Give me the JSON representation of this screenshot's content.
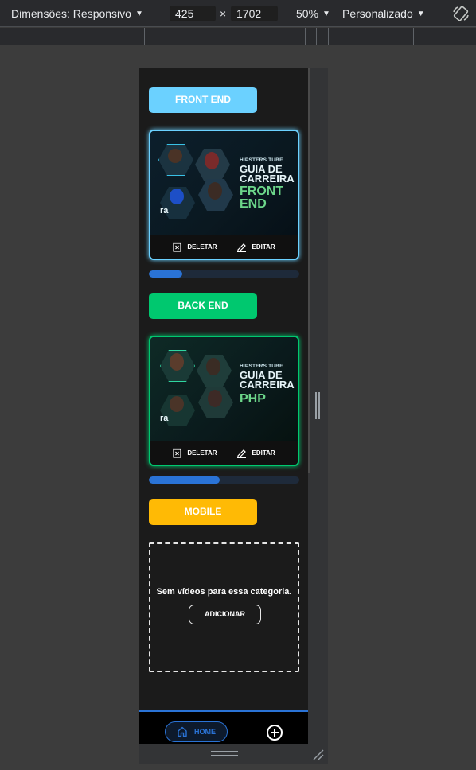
{
  "toolbar": {
    "dimensions_label": "Dimensões: Responsivo",
    "width": "425",
    "height": "1702",
    "times": "×",
    "zoom": "50%",
    "throttle": "Personalizado"
  },
  "categories": [
    {
      "label": "FRONT END",
      "color": "#6bd1ff",
      "card": {
        "brand": "HIPSTERS.TUBE",
        "title_line1": "GUIA DE",
        "title_line2": "CARREIRA",
        "title_line3": "FRONT",
        "title_line4": "END",
        "corner_text": "ra",
        "delete_label": "DELETAR",
        "edit_label": "EDITAR"
      },
      "progress": 0.22
    },
    {
      "label": "BACK END",
      "color": "#00c86f",
      "card": {
        "brand": "HIPSTERS.TUBE",
        "title_line1": "GUIA DE",
        "title_line2": "CARREIRA",
        "title_line3": "PHP",
        "corner_text": "ra",
        "delete_label": "DELETAR",
        "edit_label": "EDITAR"
      },
      "progress": 0.47
    },
    {
      "label": "MOBILE",
      "color": "#ffba05",
      "empty_text": "Sem vídeos para essa categoria.",
      "add_label": "ADICIONAR"
    }
  ],
  "bottom_nav": {
    "home_label": "HOME",
    "accent": "#2a73d6"
  },
  "icons": [
    "chevron-down-icon",
    "rotate-icon",
    "trash-icon",
    "pencil-icon",
    "home-icon",
    "plus-circle-icon",
    "resize-handle-icon"
  ]
}
